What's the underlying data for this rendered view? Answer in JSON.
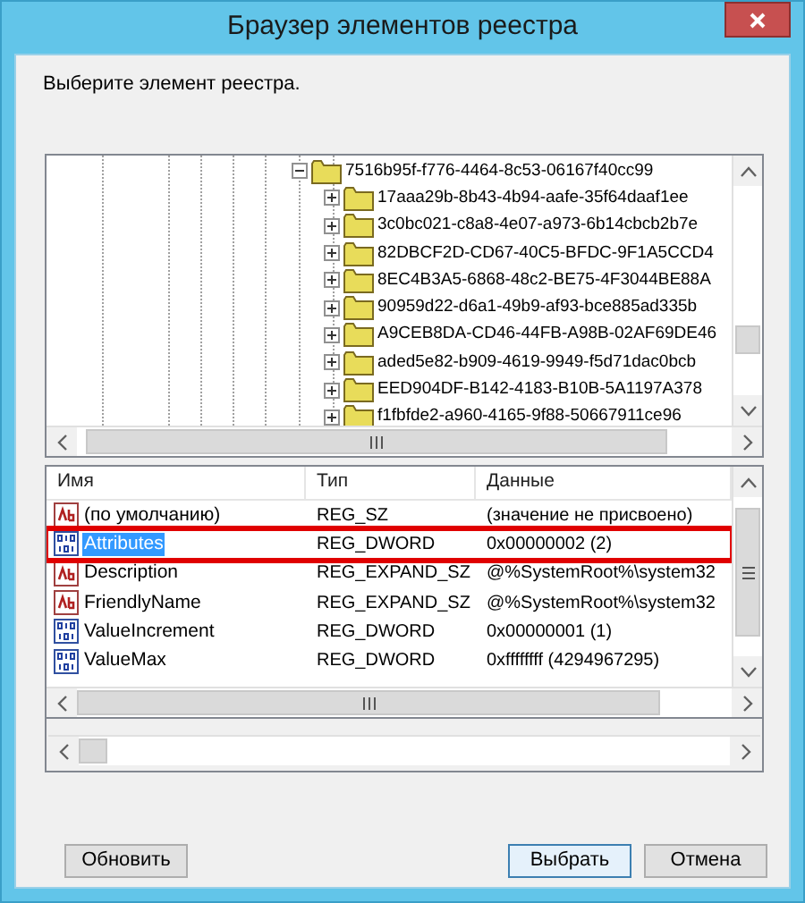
{
  "window": {
    "title": "Браузер элементов реестра"
  },
  "prompt": "Выберите элемент реестра.",
  "tree": {
    "root": {
      "label": "7516b95f-f776-4464-8c53-06167f40cc99",
      "expanded": true,
      "children": [
        {
          "label": "17aaa29b-8b43-4b94-aafe-35f64daaf1ee",
          "expanded": false
        },
        {
          "label": "3c0bc021-c8a8-4e07-a973-6b14cbcb2b7e",
          "expanded": false
        },
        {
          "label": "82DBCF2D-CD67-40C5-BFDC-9F1A5CCD4",
          "expanded": false
        },
        {
          "label": "8EC4B3A5-6868-48c2-BE75-4F3044BE88A",
          "expanded": false
        },
        {
          "label": "90959d22-d6a1-49b9-af93-bce885ad335b",
          "expanded": false
        },
        {
          "label": "A9CEB8DA-CD46-44FB-A98B-02AF69DE46",
          "expanded": false
        },
        {
          "label": "aded5e82-b909-4619-9949-f5d71dac0bcb",
          "expanded": false
        },
        {
          "label": "EED904DF-B142-4183-B10B-5A1197A378",
          "expanded": false
        },
        {
          "label": "f1fbfde2-a960-4165-9f88-50667911ce96",
          "expanded": false
        }
      ]
    }
  },
  "values_list": {
    "columns": [
      "Имя",
      "Тип",
      "Данные"
    ],
    "rows": [
      {
        "kind": "string",
        "name": "(по умолчанию)",
        "type": "REG_SZ",
        "data": "(значение не присвоено)",
        "selected": false,
        "outlined": false
      },
      {
        "kind": "binary",
        "name": "Attributes",
        "type": "REG_DWORD",
        "data": "0x00000002 (2)",
        "selected": true,
        "outlined": true
      },
      {
        "kind": "string",
        "name": "Description",
        "type": "REG_EXPAND_SZ",
        "data": "@%SystemRoot%\\system32",
        "selected": false,
        "outlined": false
      },
      {
        "kind": "string",
        "name": "FriendlyName",
        "type": "REG_EXPAND_SZ",
        "data": "@%SystemRoot%\\system32",
        "selected": false,
        "outlined": false
      },
      {
        "kind": "binary",
        "name": "ValueIncrement",
        "type": "REG_DWORD",
        "data": "0x00000001 (1)",
        "selected": false,
        "outlined": false
      },
      {
        "kind": "binary",
        "name": "ValueMax",
        "type": "REG_DWORD",
        "data": "0xffffffff (4294967295)",
        "selected": false,
        "outlined": false
      }
    ]
  },
  "buttons": [
    {
      "label": "Обновить",
      "default": false
    },
    {
      "label": "Выбрать",
      "default": true
    },
    {
      "label": "Отмена",
      "default": false
    }
  ]
}
